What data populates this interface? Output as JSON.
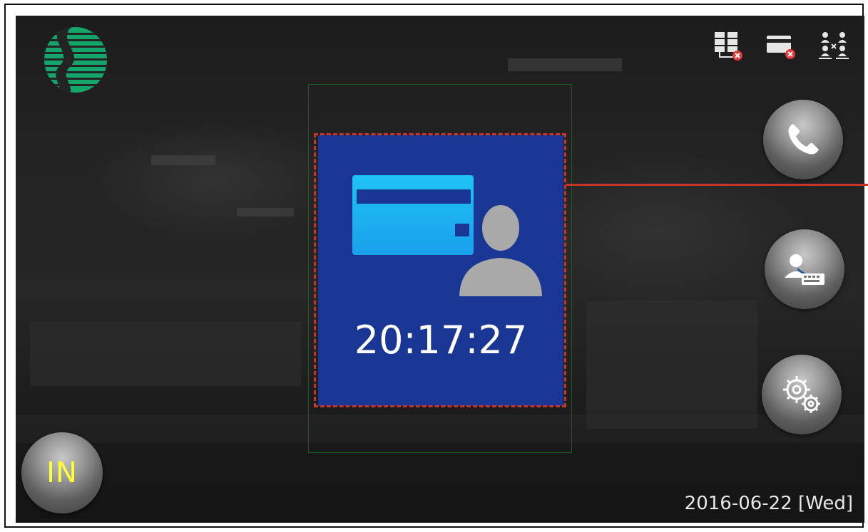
{
  "device_screen": {
    "time": "20:17:27",
    "date": "2016-06-22 [Wed]",
    "attendance_state": "IN"
  },
  "status_bar": {
    "icons": [
      "server-disconnected-icon",
      "card-reader-disconnected-icon",
      "network-topology-icon"
    ]
  },
  "side_buttons": {
    "icons": [
      "phone-icon",
      "user-keyboard-icon",
      "gear-icon"
    ]
  },
  "verification_panel": {
    "icon": "card-and-user-icon"
  },
  "colors": {
    "panel_bg": "#1a3695",
    "highlight": "#c5352a",
    "in_label": "#ffff33",
    "card": "#19b6ef",
    "logo_green": "#13a56a"
  }
}
